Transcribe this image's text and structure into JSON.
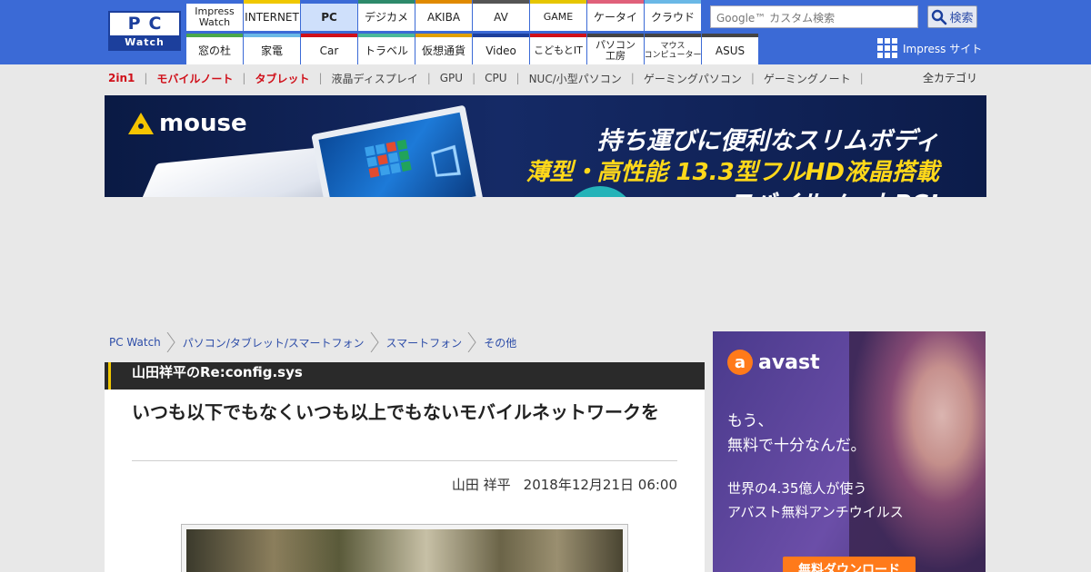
{
  "header": {
    "logo_top": "PC",
    "logo_bottom": "Watch",
    "nav_row1": [
      {
        "label": "Impress\nWatch",
        "color": "#3b6ad6"
      },
      {
        "label": "INTERNET",
        "color": "#f0c800"
      },
      {
        "label": "PC",
        "color": "#3b6ad6",
        "active": true
      },
      {
        "label": "デジカメ",
        "color": "#2d8a6b"
      },
      {
        "label": "AKIBA",
        "color": "#e08a00"
      },
      {
        "label": "AV",
        "color": "#555555"
      },
      {
        "label": "GAME",
        "color": "#e6c600"
      },
      {
        "label": "ケータイ",
        "color": "#e0607a"
      },
      {
        "label": "クラウド",
        "color": "#6ab8e6"
      }
    ],
    "nav_row2": [
      {
        "label": "窓の杜",
        "color": "#4aa84a"
      },
      {
        "label": "家電",
        "color": "#6ab8e6"
      },
      {
        "label": "Car",
        "color": "#d0101a"
      },
      {
        "label": "トラベル",
        "color": "#4ab89a"
      },
      {
        "label": "仮想通貨",
        "color": "#e0a000"
      },
      {
        "label": "Video",
        "color": "#1c3f9c"
      },
      {
        "label": "こどもとIT",
        "color": "#d0101a"
      },
      {
        "label": "パソコン\n工房",
        "color": "#444444"
      },
      {
        "label": "マウス\nコンピューター",
        "color": "#444444"
      },
      {
        "label": "ASUS",
        "color": "#444444"
      }
    ],
    "search_placeholder": "Google™ カスタム検索",
    "search_button": "検索",
    "impress_sites": "Impress サイト"
  },
  "categories": {
    "items": [
      {
        "label": "2in1",
        "highlight": true
      },
      {
        "label": "モバイルノート",
        "highlight": true
      },
      {
        "label": "タブレット",
        "highlight": true
      },
      {
        "label": "液晶ディスプレイ",
        "highlight": false
      },
      {
        "label": "GPU",
        "highlight": false
      },
      {
        "label": "CPU",
        "highlight": false
      },
      {
        "label": "NUC/小型パソコン",
        "highlight": false
      },
      {
        "label": "ゲーミングパソコン",
        "highlight": false
      },
      {
        "label": "ゲーミングノート",
        "highlight": false
      }
    ],
    "all_label": "全カテゴリ"
  },
  "banner": {
    "brand": "mouse",
    "line1": "持ち運びに便利なスリムボディ",
    "line2": "薄型・高性能 13.3型フルHD液晶搭載",
    "line3": "モバイルノートPC!"
  },
  "breadcrumb": [
    "PC Watch",
    "パソコン/タブレット/スマートフォン",
    "スマートフォン",
    "その他"
  ],
  "article": {
    "series": "山田祥平のRe:config.sys",
    "headline": "いつも以下でもなくいつも以上でもないモバイルネットワークを",
    "author": "山田 祥平",
    "date": "2018年12月21日 06:00"
  },
  "side_ad": {
    "brand": "avast",
    "line1": "もう、",
    "line2": "無料で十分なんだ。",
    "line3": "世界の4.35億人が使う",
    "line4": "アバスト無料アンチウイルス",
    "cta": "無料ダウンロード"
  }
}
